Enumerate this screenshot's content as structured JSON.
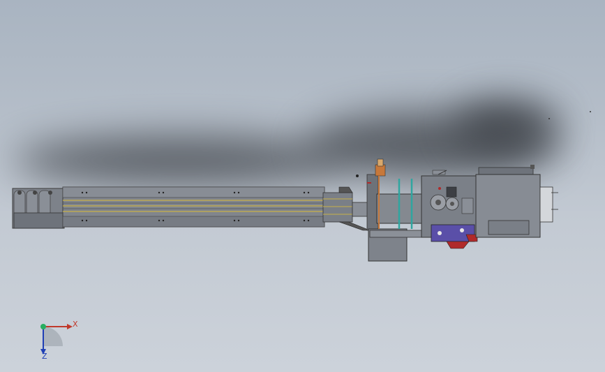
{
  "viewport": {
    "background_top": "#a9b4c1",
    "background_bottom": "#ccd2da"
  },
  "triad": {
    "x_label": "X",
    "z_label": "Z",
    "x_color": "#c0392b",
    "y_color": "#27ae60",
    "z_color": "#1f3fb5"
  },
  "model": {
    "body_color": "#7d828a",
    "rail_color": "#c8b04a",
    "accent_purple": "#5a4fa8",
    "accent_red": "#b02a2a",
    "accent_teal": "#2fa6a0",
    "accent_orange": "#c7783a"
  }
}
